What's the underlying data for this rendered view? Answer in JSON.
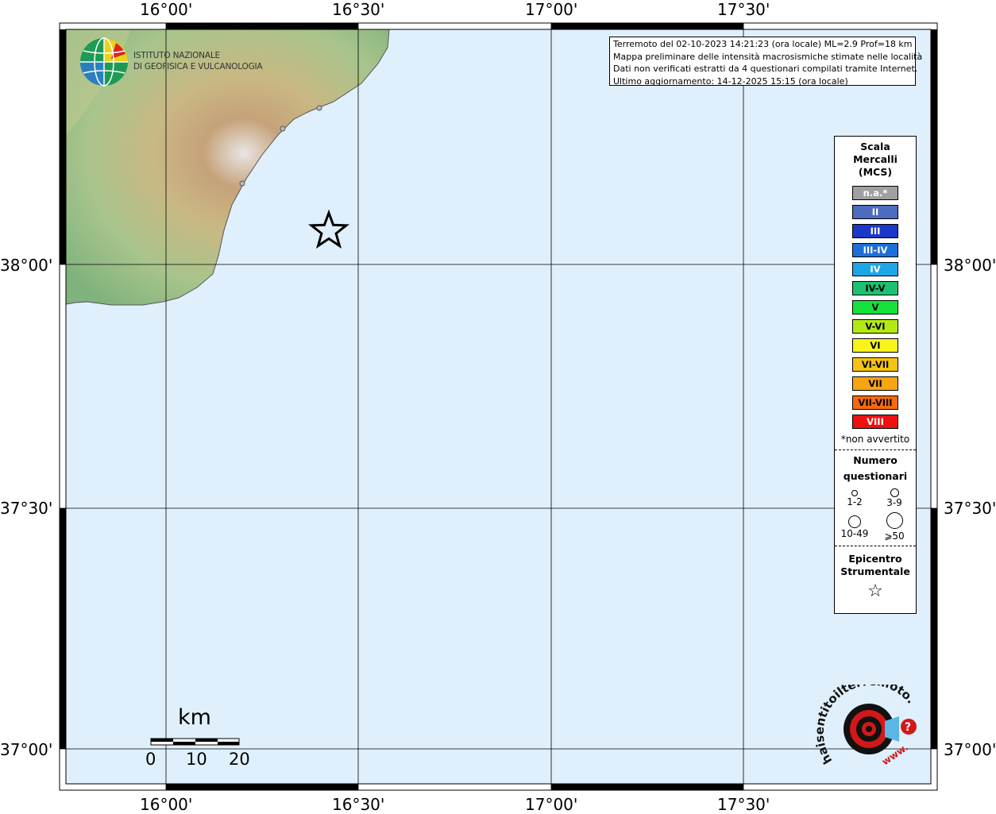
{
  "map": {
    "top_labels": [
      "16°00'",
      "16°30'",
      "17°00'",
      "17°30'"
    ],
    "bottom_labels": [
      "16°00'",
      "16°30'",
      "17°00'",
      "17°30'"
    ],
    "left_labels": [
      "38°00'",
      "37°30'",
      "37°00'"
    ],
    "right_labels": [
      "38°00'",
      "37°30'",
      "37°00'"
    ],
    "sea_color": "#dff0fc"
  },
  "logo_ingv": {
    "line1": "ISTITUTO NAZIONALE",
    "line2": "DI GEOFISICA E VULCANOLOGIA"
  },
  "info": {
    "line1": "Terremoto del 02-10-2023 14:21:23 (ora locale) ML=2.9 Prof=18 km",
    "line2": "Mappa preliminare delle intensità macrosismiche stimate nelle località",
    "line3": "Dati non verificati estratti da 4 questionari compilati tramite Internet.",
    "line4": "Ultimo aggiornamento: 14-12-2025 15:15 (ora locale)"
  },
  "legend": {
    "title_line1": "Scala",
    "title_line2": "Mercalli",
    "title_line3": "(MCS)",
    "items": [
      {
        "label": "n.a.*",
        "color": "#a0a0a0",
        "text_color": "#ffffff"
      },
      {
        "label": "II",
        "color": "#4d6bbf",
        "text_color": "#ffffff"
      },
      {
        "label": "III",
        "color": "#1b38c8",
        "text_color": "#ffffff"
      },
      {
        "label": "III-IV",
        "color": "#1c6fd9",
        "text_color": "#ffffff"
      },
      {
        "label": "IV",
        "color": "#1ca7e8",
        "text_color": "#ffffff"
      },
      {
        "label": "IV-V",
        "color": "#1bc271",
        "text_color": "#000000"
      },
      {
        "label": "V",
        "color": "#14e23b",
        "text_color": "#000000"
      },
      {
        "label": "V-VI",
        "color": "#b4ea14",
        "text_color": "#000000"
      },
      {
        "label": "VI",
        "color": "#f8f41a",
        "text_color": "#000000"
      },
      {
        "label": "VI-VII",
        "color": "#f5c312",
        "text_color": "#000000"
      },
      {
        "label": "VII",
        "color": "#f7a512",
        "text_color": "#000000"
      },
      {
        "label": "VII-VIII",
        "color": "#f56a10",
        "text_color": "#000000"
      },
      {
        "label": "VIII",
        "color": "#ee1111",
        "text_color": "#ffffff"
      }
    ],
    "footnote": "*non avvertito",
    "questionari_title1": "Numero",
    "questionari_title2": "questionari",
    "q_labels": [
      "1-2",
      "3-9",
      "10-49",
      "⩾50"
    ],
    "epi_title1": "Epicentro",
    "epi_title2": "Strumentale",
    "star_symbol": "☆"
  },
  "scalebar": {
    "unit": "km",
    "ticks": [
      "0",
      "10",
      "20"
    ]
  },
  "logo_hst": {
    "text": "haisentitoilterremoto.it",
    "www": "www."
  }
}
